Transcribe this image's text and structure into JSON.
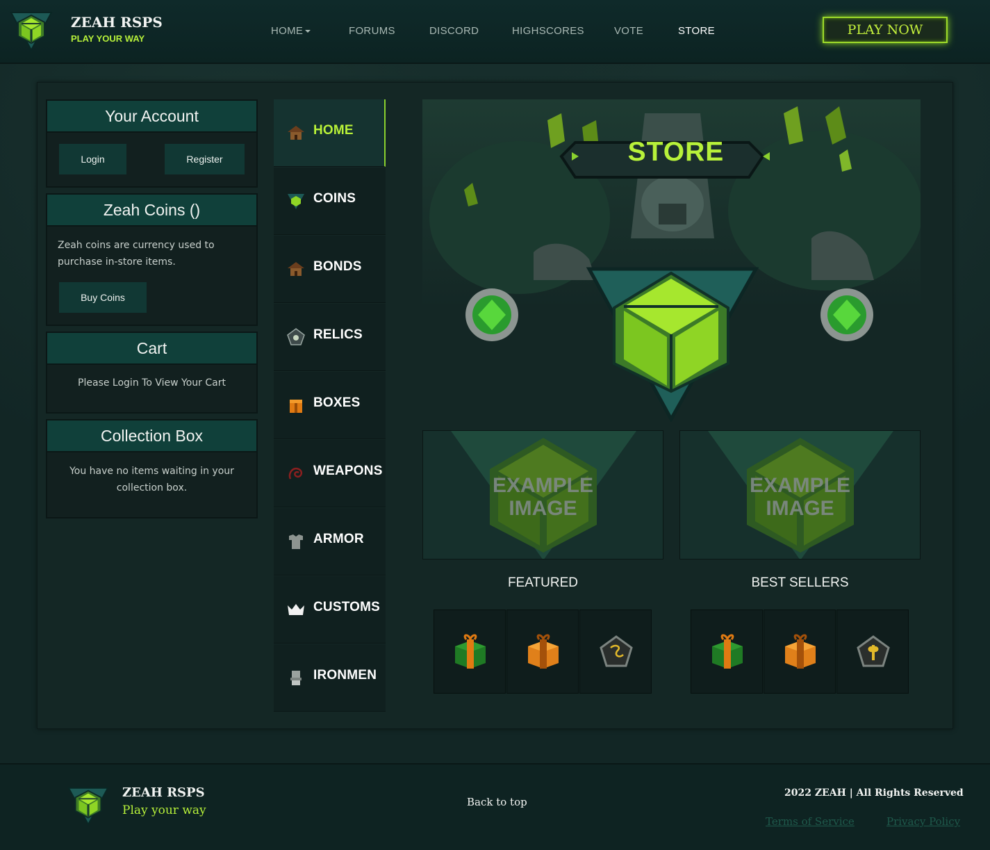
{
  "colors": {
    "accent": "#b7f13a",
    "panel": "#142725",
    "card_head": "#10403a"
  },
  "header": {
    "brand_title": "ZEAH RSPS",
    "brand_subtitle": "PLAY YOUR WAY",
    "logo_icon": "zeah-logo-icon",
    "nav": [
      {
        "label": "HOME",
        "has_dropdown": true
      },
      {
        "label": "FORUMS"
      },
      {
        "label": "DISCORD"
      },
      {
        "label": "HIGHSCORES"
      },
      {
        "label": "VOTE"
      },
      {
        "label": "STORE",
        "active": true
      }
    ],
    "play_now": "PLAY NOW"
  },
  "sidebar": {
    "account": {
      "title": "Your Account",
      "login": "Login",
      "register": "Register"
    },
    "coins": {
      "title": "Zeah Coins ()",
      "desc_line1": "Zeah coins are currency used to",
      "desc_line2": "purchase in-store items.",
      "buy": "Buy Coins"
    },
    "cart": {
      "title": "Cart",
      "message": "Please Login To View Your Cart"
    },
    "collection": {
      "title": "Collection Box",
      "msg_line1": "You have no items waiting in your",
      "msg_line2": "collection box."
    }
  },
  "categories": [
    {
      "label": "HOME",
      "icon": "house-icon",
      "active": true
    },
    {
      "label": "COINS",
      "icon": "zeah-coin-icon"
    },
    {
      "label": "BONDS",
      "icon": "bond-house-icon"
    },
    {
      "label": "RELICS",
      "icon": "relic-icon"
    },
    {
      "label": "BOXES",
      "icon": "mystery-box-icon"
    },
    {
      "label": "WEAPONS",
      "icon": "whip-icon"
    },
    {
      "label": "ARMOR",
      "icon": "platebody-icon"
    },
    {
      "label": "CUSTOMS",
      "icon": "crown-icon"
    },
    {
      "label": "IRONMEN",
      "icon": "ironman-helm-icon"
    }
  ],
  "banner": {
    "title": "STORE"
  },
  "showcase": {
    "example_line1": "EXAMPLE",
    "example_line2": "IMAGE",
    "featured_label": "FEATURED",
    "bestsellers_label": "BEST SELLERS",
    "featured_items": [
      "green-gift-icon",
      "orange-gift-icon",
      "rune-pentagon-icon"
    ],
    "bestseller_items": [
      "green-gift-icon",
      "orange-gift-icon",
      "axe-pentagon-icon"
    ]
  },
  "footer": {
    "title": "ZEAH RSPS",
    "subtitle": "Play your way",
    "back_to_top": "Back to top",
    "copyright": "2022 ZEAH | All Rights Reserved",
    "terms": "Terms of Service",
    "privacy": "Privacy Policy"
  }
}
